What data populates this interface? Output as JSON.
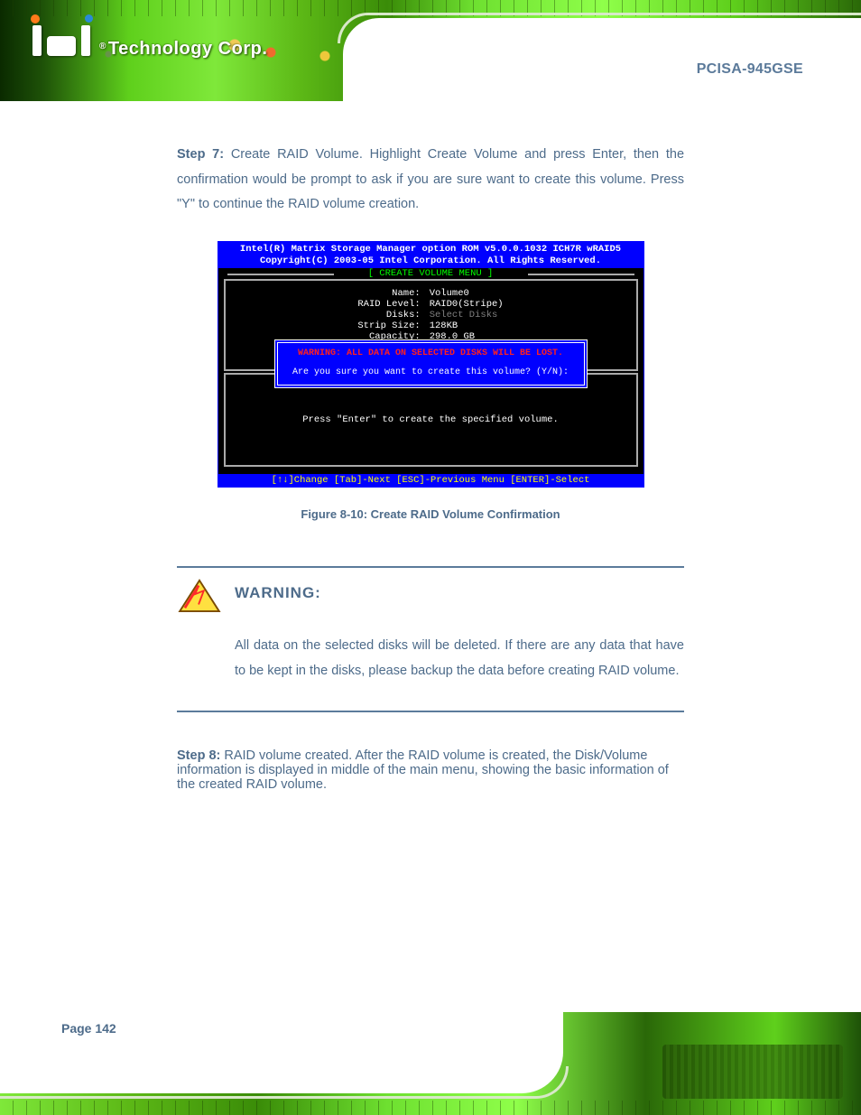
{
  "header": {
    "logo_text_prefix": "®",
    "logo_text": "Technology Corp.",
    "product_title": "PCISA-945GSE"
  },
  "step7": {
    "prefix": "Step 7: ",
    "text": "Create RAID Volume. Highlight Create Volume and press Enter, then the confirmation would be prompt to ask if you are sure want to create this volume. Press \"Y\" to continue the RAID volume creation."
  },
  "bios": {
    "title1": "Intel(R) Matrix Storage Manager option ROM v5.0.0.1032 ICH7R wRAID5",
    "title2": "Copyright(C) 2003-05 Intel Corporation.  All Rights Reserved.",
    "menu_label": "[ CREATE VOLUME MENU ]",
    "fields": {
      "name_label": "Name:",
      "name_value": "Volume0",
      "raid_label": "RAID Level:",
      "raid_value": "RAID0(Stripe)",
      "disks_label": "Disks:",
      "disks_value": "Select Disks",
      "strip_label": "Strip Size:",
      "strip_value": "128KB",
      "cap_label": "Capacity:",
      "cap_value": "298.0 GB"
    },
    "warning_line": "WARNING: ALL DATA ON SELECTED DISKS WILL BE LOST.",
    "confirm_line": "Are you sure you want to create this volume? (Y/N):",
    "help_box": "Press \"Enter\" to create the specified volume.",
    "footer": "[↑↓]Change   [Tab]-Next   [ESC]-Previous Menu   [ENTER]-Select"
  },
  "figure_caption": "Figure 8-10: Create RAID Volume Confirmation",
  "warning": {
    "title": "WARNING:",
    "body": "All data on the selected disks will be deleted. If there are any data that have to be kept in the disks, please backup the data before creating RAID volume."
  },
  "step8": {
    "prefix": "Step 8: ",
    "text": "RAID volume created. After the RAID volume is created, the Disk/Volume information is displayed in middle of the main menu, showing the basic information of the created RAID volume."
  },
  "page_number": "Page 142"
}
